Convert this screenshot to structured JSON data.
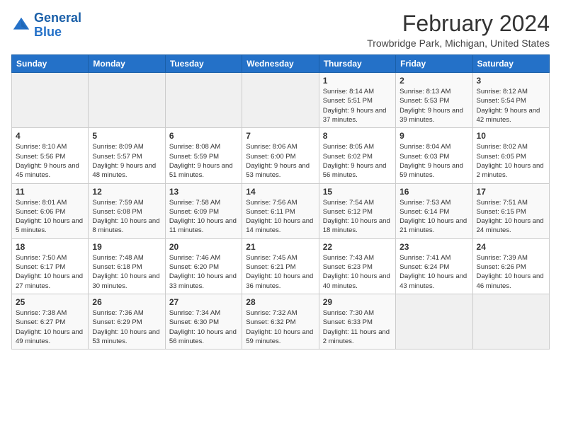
{
  "logo": {
    "text_general": "General",
    "text_blue": "Blue"
  },
  "title": "February 2024",
  "subtitle": "Trowbridge Park, Michigan, United States",
  "days_of_week": [
    "Sunday",
    "Monday",
    "Tuesday",
    "Wednesday",
    "Thursday",
    "Friday",
    "Saturday"
  ],
  "weeks": [
    [
      {
        "day": "",
        "info": ""
      },
      {
        "day": "",
        "info": ""
      },
      {
        "day": "",
        "info": ""
      },
      {
        "day": "",
        "info": ""
      },
      {
        "day": "1",
        "info": "Sunrise: 8:14 AM\nSunset: 5:51 PM\nDaylight: 9 hours and 37 minutes."
      },
      {
        "day": "2",
        "info": "Sunrise: 8:13 AM\nSunset: 5:53 PM\nDaylight: 9 hours and 39 minutes."
      },
      {
        "day": "3",
        "info": "Sunrise: 8:12 AM\nSunset: 5:54 PM\nDaylight: 9 hours and 42 minutes."
      }
    ],
    [
      {
        "day": "4",
        "info": "Sunrise: 8:10 AM\nSunset: 5:56 PM\nDaylight: 9 hours and 45 minutes."
      },
      {
        "day": "5",
        "info": "Sunrise: 8:09 AM\nSunset: 5:57 PM\nDaylight: 9 hours and 48 minutes."
      },
      {
        "day": "6",
        "info": "Sunrise: 8:08 AM\nSunset: 5:59 PM\nDaylight: 9 hours and 51 minutes."
      },
      {
        "day": "7",
        "info": "Sunrise: 8:06 AM\nSunset: 6:00 PM\nDaylight: 9 hours and 53 minutes."
      },
      {
        "day": "8",
        "info": "Sunrise: 8:05 AM\nSunset: 6:02 PM\nDaylight: 9 hours and 56 minutes."
      },
      {
        "day": "9",
        "info": "Sunrise: 8:04 AM\nSunset: 6:03 PM\nDaylight: 9 hours and 59 minutes."
      },
      {
        "day": "10",
        "info": "Sunrise: 8:02 AM\nSunset: 6:05 PM\nDaylight: 10 hours and 2 minutes."
      }
    ],
    [
      {
        "day": "11",
        "info": "Sunrise: 8:01 AM\nSunset: 6:06 PM\nDaylight: 10 hours and 5 minutes."
      },
      {
        "day": "12",
        "info": "Sunrise: 7:59 AM\nSunset: 6:08 PM\nDaylight: 10 hours and 8 minutes."
      },
      {
        "day": "13",
        "info": "Sunrise: 7:58 AM\nSunset: 6:09 PM\nDaylight: 10 hours and 11 minutes."
      },
      {
        "day": "14",
        "info": "Sunrise: 7:56 AM\nSunset: 6:11 PM\nDaylight: 10 hours and 14 minutes."
      },
      {
        "day": "15",
        "info": "Sunrise: 7:54 AM\nSunset: 6:12 PM\nDaylight: 10 hours and 18 minutes."
      },
      {
        "day": "16",
        "info": "Sunrise: 7:53 AM\nSunset: 6:14 PM\nDaylight: 10 hours and 21 minutes."
      },
      {
        "day": "17",
        "info": "Sunrise: 7:51 AM\nSunset: 6:15 PM\nDaylight: 10 hours and 24 minutes."
      }
    ],
    [
      {
        "day": "18",
        "info": "Sunrise: 7:50 AM\nSunset: 6:17 PM\nDaylight: 10 hours and 27 minutes."
      },
      {
        "day": "19",
        "info": "Sunrise: 7:48 AM\nSunset: 6:18 PM\nDaylight: 10 hours and 30 minutes."
      },
      {
        "day": "20",
        "info": "Sunrise: 7:46 AM\nSunset: 6:20 PM\nDaylight: 10 hours and 33 minutes."
      },
      {
        "day": "21",
        "info": "Sunrise: 7:45 AM\nSunset: 6:21 PM\nDaylight: 10 hours and 36 minutes."
      },
      {
        "day": "22",
        "info": "Sunrise: 7:43 AM\nSunset: 6:23 PM\nDaylight: 10 hours and 40 minutes."
      },
      {
        "day": "23",
        "info": "Sunrise: 7:41 AM\nSunset: 6:24 PM\nDaylight: 10 hours and 43 minutes."
      },
      {
        "day": "24",
        "info": "Sunrise: 7:39 AM\nSunset: 6:26 PM\nDaylight: 10 hours and 46 minutes."
      }
    ],
    [
      {
        "day": "25",
        "info": "Sunrise: 7:38 AM\nSunset: 6:27 PM\nDaylight: 10 hours and 49 minutes."
      },
      {
        "day": "26",
        "info": "Sunrise: 7:36 AM\nSunset: 6:29 PM\nDaylight: 10 hours and 53 minutes."
      },
      {
        "day": "27",
        "info": "Sunrise: 7:34 AM\nSunset: 6:30 PM\nDaylight: 10 hours and 56 minutes."
      },
      {
        "day": "28",
        "info": "Sunrise: 7:32 AM\nSunset: 6:32 PM\nDaylight: 10 hours and 59 minutes."
      },
      {
        "day": "29",
        "info": "Sunrise: 7:30 AM\nSunset: 6:33 PM\nDaylight: 11 hours and 2 minutes."
      },
      {
        "day": "",
        "info": ""
      },
      {
        "day": "",
        "info": ""
      }
    ]
  ]
}
